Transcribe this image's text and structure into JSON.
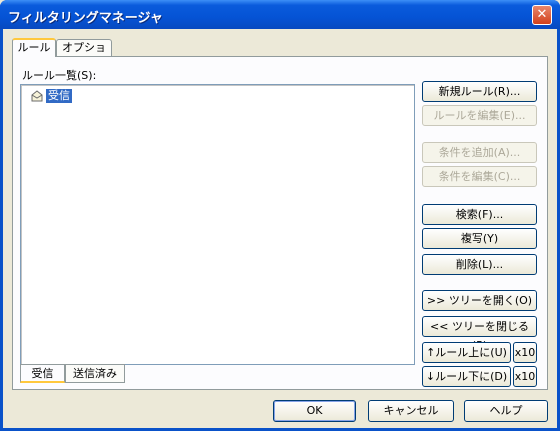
{
  "window": {
    "title": "フィルタリングマネージャ",
    "close_label": "✕"
  },
  "tabs": [
    {
      "label": "ルール"
    },
    {
      "label": "オプション"
    }
  ],
  "rules": {
    "list_label": "ルール一覧(S):",
    "items": [
      {
        "label": "受信",
        "selected": true
      }
    ]
  },
  "side_buttons": {
    "new_rule": "新規ルール(R)...",
    "edit_rule": "ルールを編集(E)...",
    "add_condition": "条件を追加(A)...",
    "edit_condition": "条件を編集(C)...",
    "search": "検索(F)...",
    "copy": "複写(Y)",
    "delete": "削除(L)...",
    "expand_tree": ">> ツリーを開く(O)",
    "collapse_tree": "<< ツリーを閉じる(P)",
    "move_up": "↑ルール上に(U)",
    "move_up_x10": "x10",
    "move_down": "↓ルール下に(D)",
    "move_down_x10": "x10"
  },
  "bottom_tabs": [
    {
      "label": "受信"
    },
    {
      "label": "送信済み"
    }
  ],
  "dialog_buttons": {
    "ok": "OK",
    "cancel": "キャンセル",
    "help": "ヘルプ"
  },
  "colors": {
    "titlebar": "#0553d5",
    "selection": "#316ac5",
    "face": "#ece9d8"
  }
}
